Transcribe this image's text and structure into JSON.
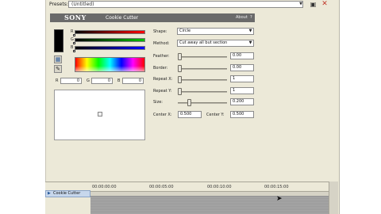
{
  "presets": {
    "label": "Presets:",
    "value": "(Untitled)"
  },
  "header": {
    "brand": "SONY",
    "title": "Cookie Cutter",
    "about": "About",
    "arrow": "?"
  },
  "color": {
    "rgb_labels": [
      "R",
      "G",
      "B"
    ],
    "fields": [
      {
        "label": "R",
        "value": "0"
      },
      {
        "label": "G",
        "value": "0"
      },
      {
        "label": "B",
        "value": "0"
      }
    ],
    "swatch_hex": "#000000"
  },
  "properties": {
    "shape": {
      "label": "Shape:",
      "value": "Circle"
    },
    "method": {
      "label": "Method:",
      "value": "Cut away all but section"
    },
    "feather": {
      "label": "Feather:",
      "value": "0.00",
      "level": 0.0
    },
    "border": {
      "label": "Border:",
      "value": "0.00",
      "level": 0.0
    },
    "repeat_x": {
      "label": "Repeat X:",
      "value": "1",
      "level": 0.0
    },
    "repeat_y": {
      "label": "Repeat Y:",
      "value": "1",
      "level": 0.0
    },
    "size": {
      "label": "Size:",
      "value": "0.200",
      "level": 0.2
    },
    "center_x": {
      "label": "Center X:",
      "value": "0.500"
    },
    "center_y": {
      "label": "Center Y:",
      "value": "0.500"
    }
  },
  "timeline": {
    "track_label": "Cookie Cutter",
    "timecodes": [
      "00:00:00:00",
      "00:00:05:00",
      "00:00:10:00",
      "00:00:15:00"
    ]
  },
  "icons": {
    "save": "save-icon",
    "close": "close-icon",
    "palette": "palette-icon",
    "eyedropper": "eyedropper-icon"
  },
  "colors": {
    "header": "#6a6a6a",
    "window": "#ece9d8",
    "track_highlight": "#c7d7ec"
  }
}
